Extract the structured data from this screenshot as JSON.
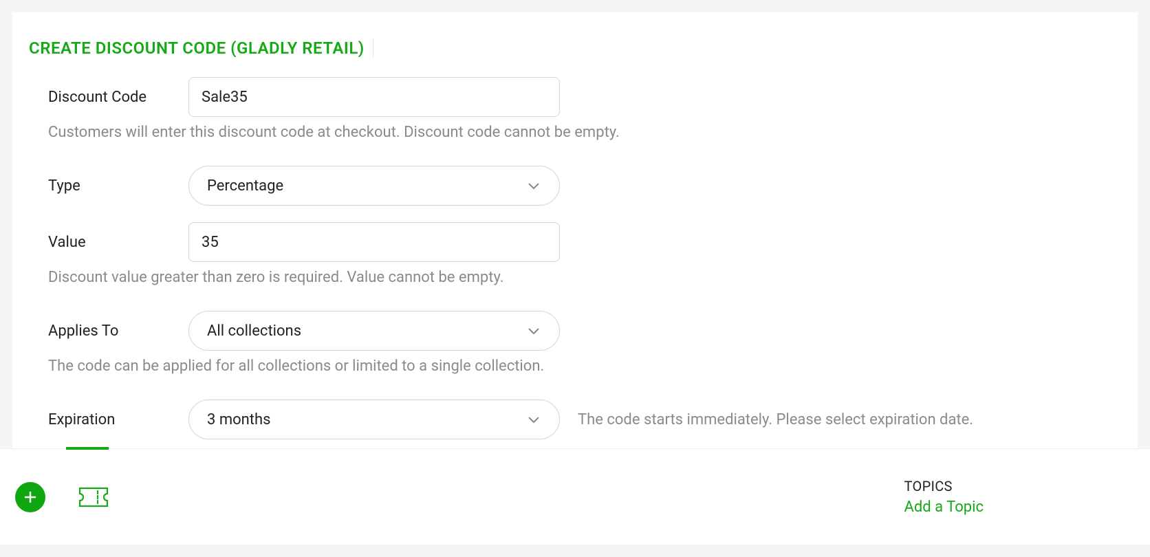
{
  "card": {
    "title": "CREATE DISCOUNT CODE (GLADLY RETAIL)"
  },
  "form": {
    "discountCode": {
      "label": "Discount Code",
      "value": "Sale35",
      "help": "Customers will enter this discount code at checkout. Discount code cannot be empty."
    },
    "type": {
      "label": "Type",
      "value": "Percentage"
    },
    "value": {
      "label": "Value",
      "value": "35",
      "help": "Discount value greater than zero is required. Value cannot be empty."
    },
    "appliesTo": {
      "label": "Applies To",
      "value": "All collections",
      "help": "The code can be applied for all collections or limited to a single collection."
    },
    "expiration": {
      "label": "Expiration",
      "value": "3 months",
      "sideHelp": "The code starts immediately. Please select expiration date."
    }
  },
  "bottom": {
    "topicsLabel": "TOPICS",
    "addTopic": "Add a Topic"
  }
}
